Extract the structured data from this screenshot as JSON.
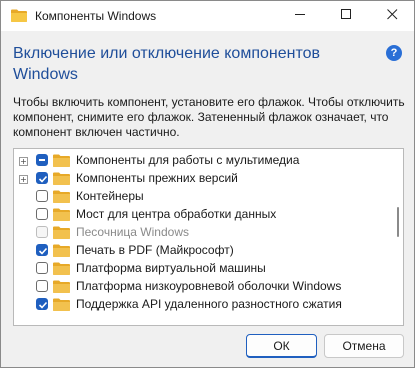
{
  "window": {
    "title": "Компоненты Windows",
    "minimize_icon": "minimize-icon",
    "maximize_icon": "maximize-icon",
    "close_icon": "close-icon"
  },
  "header": {
    "title": "Включение или отключение компонентов Windows",
    "help": "?"
  },
  "description": "Чтобы включить компонент, установите его флажок. Чтобы отключить компонент, снимите его флажок. Затененный флажок означает, что компонент включен частично.",
  "features": [
    {
      "label": "Компоненты для работы с мультимедиа",
      "state": "partial",
      "expandable": true
    },
    {
      "label": "Компоненты прежних версий",
      "state": "checked",
      "expandable": true
    },
    {
      "label": "Контейнеры",
      "state": "unchecked",
      "expandable": false
    },
    {
      "label": "Мост для центра обработки данных",
      "state": "unchecked",
      "expandable": false
    },
    {
      "label": "Песочница Windows",
      "state": "disabled",
      "expandable": false
    },
    {
      "label": "Печать в PDF (Майкрософт)",
      "state": "checked",
      "expandable": false
    },
    {
      "label": "Платформа виртуальной машины",
      "state": "unchecked",
      "expandable": false
    },
    {
      "label": "Платформа низкоуровневой оболочки Windows",
      "state": "unchecked",
      "expandable": false
    },
    {
      "label": "Поддержка API удаленного разностного сжатия",
      "state": "checked",
      "expandable": false
    }
  ],
  "buttons": {
    "ok": "ОК",
    "cancel": "Отмена"
  },
  "colors": {
    "accent": "#1f5fbf",
    "heading": "#1f4e9a",
    "folder": "#f2c14e"
  }
}
